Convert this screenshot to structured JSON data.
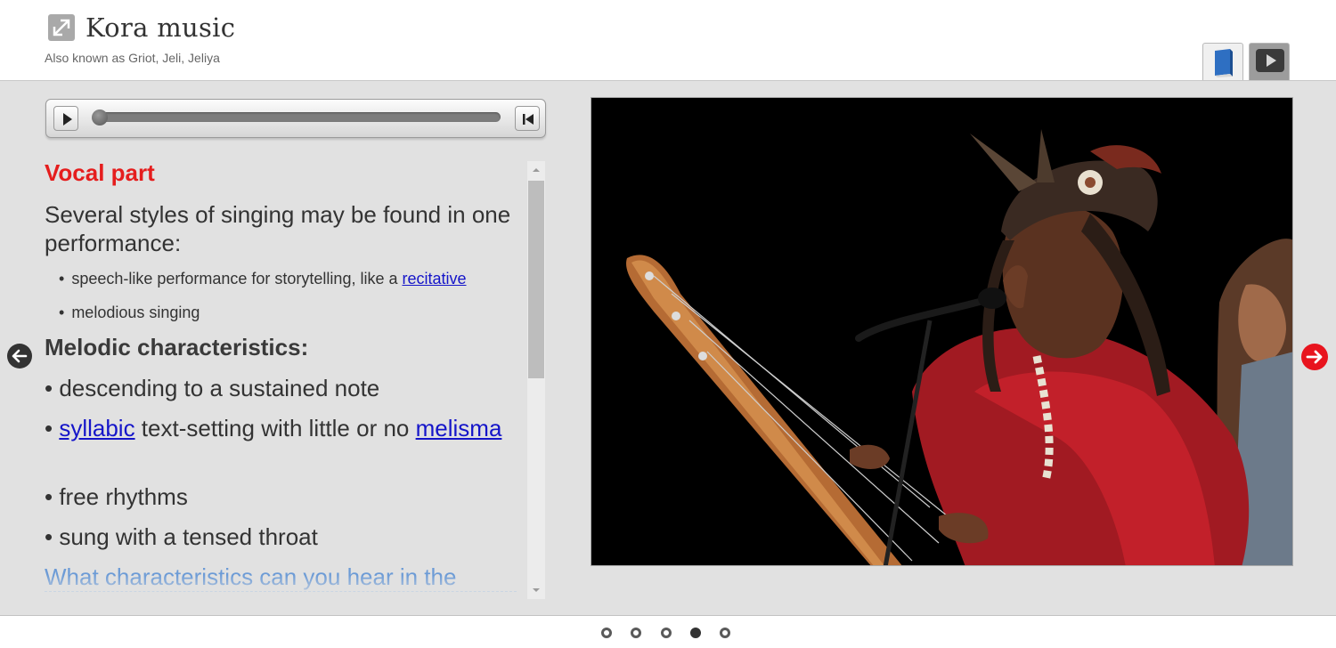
{
  "header": {
    "title": "Kora music",
    "subtitle": "Also known as Griot, Jeli, Jeliya",
    "tabs": [
      {
        "icon": "book-icon",
        "active": true
      },
      {
        "icon": "video-play-icon",
        "active": false
      }
    ]
  },
  "player": {
    "progress": 0
  },
  "content": {
    "vocal_heading": "Vocal part",
    "intro": "Several styles of singing may be found in one performance:",
    "sub_bullets": [
      {
        "text": "speech-like performance for storytelling, like a ",
        "link": "recitative"
      },
      {
        "text": "melodious singing"
      }
    ],
    "melodic_heading": "Melodic characteristics:",
    "bullets": [
      {
        "text": "descending to a sustained note"
      },
      {
        "link": "syllabic",
        "text": " text-setting with little or no ",
        "link2": "melisma"
      },
      {
        "text": "free rhythms"
      },
      {
        "text": "sung with a tensed throat"
      }
    ],
    "question": "What characteristics can you hear in the"
  },
  "pager": {
    "total": 5,
    "active_index": 3
  },
  "colors": {
    "heading_red": "#e51d1d",
    "link_blue": "#1515c9",
    "question_blue": "#6c9bd6",
    "panel_bg": "#e1e1e1",
    "next_arrow_red": "#e8141e"
  }
}
